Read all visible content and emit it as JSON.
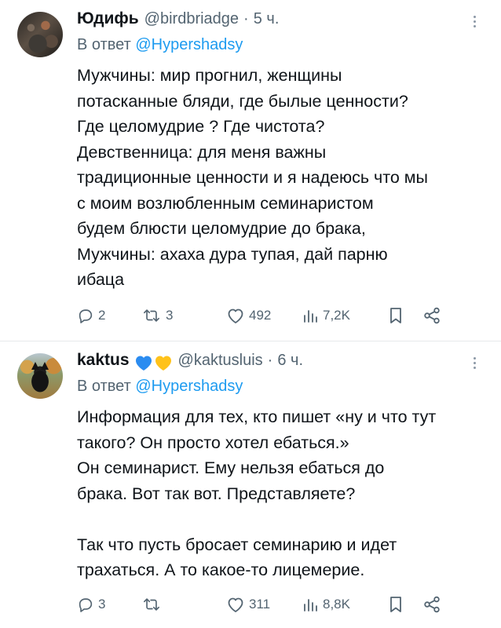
{
  "tweets": [
    {
      "display_name": "Юдифь",
      "handle": "@birdbriadge",
      "separator": "·",
      "time": "5 ч.",
      "reply_prefix": "В ответ",
      "reply_mention": "@Hypershadsy",
      "text": "Мужчины: мир прогнил, женщины\nпотасканные бляди, где былые ценности?\nГде целомудрие ? Где чистота?\nДевственница: для меня важны\nтрадиционные ценности и я надеюсь что мы\nс моим возлюбленным семинаристом\nбудем блюсти целомудрие до брака,\nМужчины: ахаха дура тупая, дай парню\nибаца",
      "replies": "2",
      "retweets": "3",
      "likes": "492",
      "views": "7,2K"
    },
    {
      "display_name": "kaktus",
      "handle": "@kaktusluis",
      "separator": "·",
      "time": "6 ч.",
      "reply_prefix": "В ответ",
      "reply_mention": "@Hypershadsy",
      "text": "Информация для тех, кто пишет «ну и что тут\nтакого? Он просто хотел ебаться.»\nОн семинарист. Ему нельзя ебаться до\nбрака. Вот так вот. Представляете?\n\nТак что пусть бросает семинарию и идет\nтрахаться. А то какое-то лицемерие.",
      "replies": "3",
      "retweets": "",
      "likes": "311",
      "views": "8,8K"
    }
  ],
  "colors": {
    "text": "#0f1419",
    "secondary": "#536471",
    "accent": "#1d9bf0",
    "heart_blue": "#2b8cf0",
    "heart_yellow": "#ffc21a"
  },
  "icons": [
    "more-icon",
    "reply-icon",
    "retweet-icon",
    "like-icon",
    "views-icon",
    "bookmark-icon",
    "share-icon",
    "blue-heart-icon",
    "yellow-heart-icon"
  ]
}
